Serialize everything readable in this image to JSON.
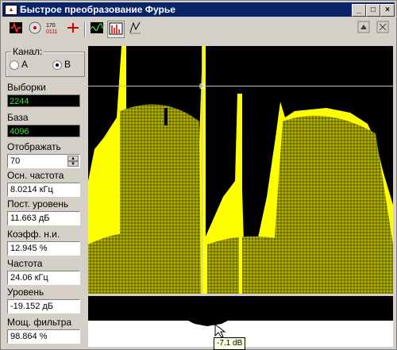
{
  "window": {
    "title": "Быстрое преобразование Фурье",
    "buttons": [
      "_",
      "□",
      "×"
    ]
  },
  "toolbar": {
    "tools": [
      {
        "name": "signal-tool-icon"
      },
      {
        "name": "settings-dial-icon"
      },
      {
        "name": "digits-tool-icon",
        "label": "170↑\n0111"
      },
      {
        "name": "marker-tool-icon"
      },
      {
        "name": "waveform-tool-icon"
      },
      {
        "name": "spectrum-tool-icon"
      },
      {
        "name": "draw-tool-icon"
      }
    ],
    "right_buttons": [
      "arrow-up-icon",
      "restore-icon"
    ]
  },
  "channel": {
    "label": "Канал:",
    "options": [
      "A",
      "B"
    ],
    "selected": "B"
  },
  "samples": {
    "label": "Выборки",
    "value": "2244"
  },
  "base": {
    "label": "База",
    "value": "4096"
  },
  "display": {
    "label": "Отображать",
    "value": "70"
  },
  "main_freq": {
    "label": "Осн. частота",
    "value": "8.0214 кГц"
  },
  "dc_level": {
    "label": "Пост. уровень",
    "value": "11.663 дБ"
  },
  "thd": {
    "label": "Коэфф. н.и.",
    "value": "12.945 %"
  },
  "freq": {
    "label": "Частота",
    "value": "24.06 кГц"
  },
  "level": {
    "label": "Уровень",
    "value": "-19.152 дБ"
  },
  "filter_power": {
    "label": "Мощ. фильтра",
    "value": "98.864 %"
  },
  "tooltip": {
    "text": "-7.1 dB"
  },
  "colors": {
    "plot_bg": "#000000",
    "trace": "#ffff00",
    "trace_dark": "#8c8c00",
    "cursor": "#c0c0c0"
  }
}
